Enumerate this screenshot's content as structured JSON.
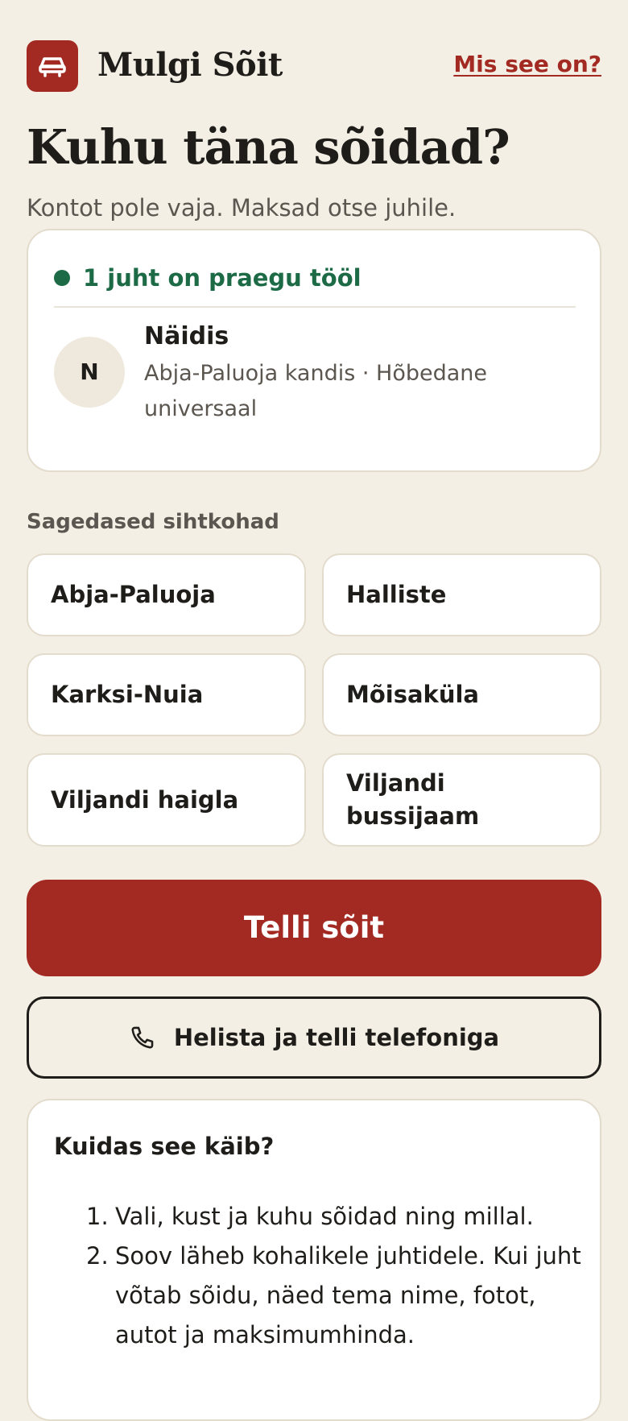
{
  "header": {
    "brand": "Mulgi Sõit",
    "logo_icon": "car-icon",
    "help_link": "Mis see on?"
  },
  "hero": {
    "title": "Kuhu täna sõidad?",
    "subtitle": "Kontot pole vaja. Maksad otse juhile."
  },
  "driver_card": {
    "status": "1 juht on praegu tööl",
    "status_color": "#1d6b46",
    "driver": {
      "initial": "N",
      "name": "Näidis",
      "description": "Abja-Paluoja kandis · Hõbedane universaal"
    }
  },
  "destinations": {
    "label": "Sagedased sihtkohad",
    "items": [
      "Abja-Paluoja",
      "Halliste",
      "Karksi-Nuia",
      "Mõisaküla",
      "Viljandi haigla",
      "Viljandi bussijaam"
    ]
  },
  "actions": {
    "order_label": "Telli sõit",
    "call_label": "Helista ja telli telefoniga",
    "call_icon": "phone-icon"
  },
  "how": {
    "title": "Kuidas see käib?",
    "steps": [
      {
        "num": "1.",
        "text": "Vali, kust ja kuhu sõidad ning millal."
      },
      {
        "num": "2.",
        "text": "Soov läheb kohalikele juhtidele. Kui juht võtab sõidu, näed tema nime, fotot, autot ja maksimumhinda."
      }
    ]
  },
  "colors": {
    "accent": "#a22a22",
    "background": "#f4efe5",
    "text": "#1f1d1a",
    "muted": "#5b564f"
  }
}
